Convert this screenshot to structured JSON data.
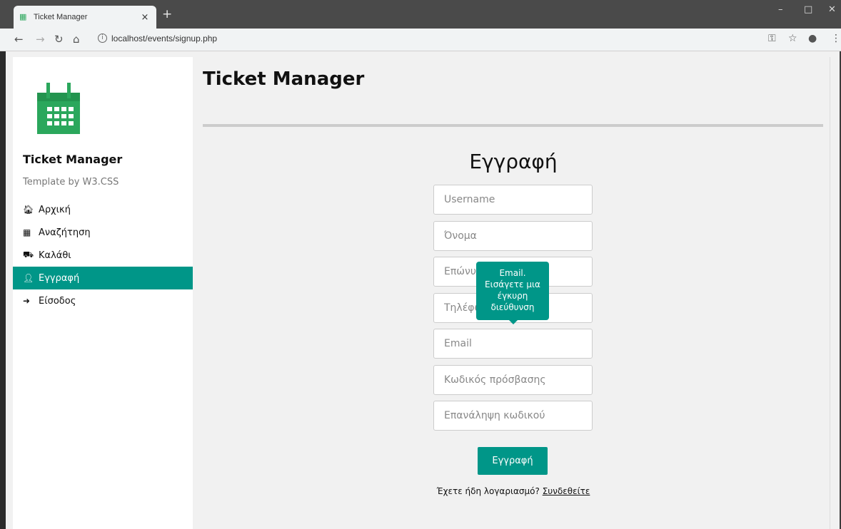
{
  "browser": {
    "tab_title": "Ticket Manager",
    "tab_close": "×",
    "new_tab": "+",
    "url": "localhost/events/signup.php",
    "window_controls": {
      "minimize": "–",
      "maximize": "□",
      "close": "✕"
    }
  },
  "sidebar": {
    "logo_icon": "calendar-icon",
    "title": "Ticket Manager",
    "subtitle": "Template by W3.CSS",
    "items": [
      {
        "label": "Αρχική",
        "icon": "home-icon",
        "glyph": "🏠︎",
        "active": false
      },
      {
        "label": "Αναζήτηση",
        "icon": "calendar-icon",
        "glyph": "▦",
        "active": false
      },
      {
        "label": "Καλάθι",
        "icon": "cart-icon",
        "glyph": "⛟",
        "active": false
      },
      {
        "label": "Εγγραφή",
        "icon": "user-plus-icon",
        "glyph": "👤︎",
        "active": true
      },
      {
        "label": "Είσοδος",
        "icon": "sign-in-icon",
        "glyph": "➜",
        "active": false
      }
    ]
  },
  "main": {
    "title": "Ticket Manager"
  },
  "form": {
    "title": "Εγγραφή",
    "fields": [
      {
        "name": "username",
        "placeholder": "Username"
      },
      {
        "name": "first-name",
        "placeholder": "Όνομα"
      },
      {
        "name": "last-name",
        "placeholder": "Επώνυμο"
      },
      {
        "name": "phone",
        "placeholder": "Τηλέφωνο"
      },
      {
        "name": "email",
        "placeholder": "Email"
      },
      {
        "name": "password",
        "placeholder": "Κωδικός πρόσβασης"
      },
      {
        "name": "password-repeat",
        "placeholder": "Επανάληψη κωδικού"
      }
    ],
    "tooltip_line1": "Email.",
    "tooltip_line2": "Εισάγετε μια",
    "tooltip_line3": "έγκυρη",
    "tooltip_line4": "διεύθυνση",
    "submit_label": "Εγγραφή",
    "signin_prompt": "Έχετε ήδη λογαριασμό?",
    "signin_link": "Συνδεθείτε"
  },
  "colors": {
    "accent": "#009688",
    "logo": "#2ba75c"
  }
}
